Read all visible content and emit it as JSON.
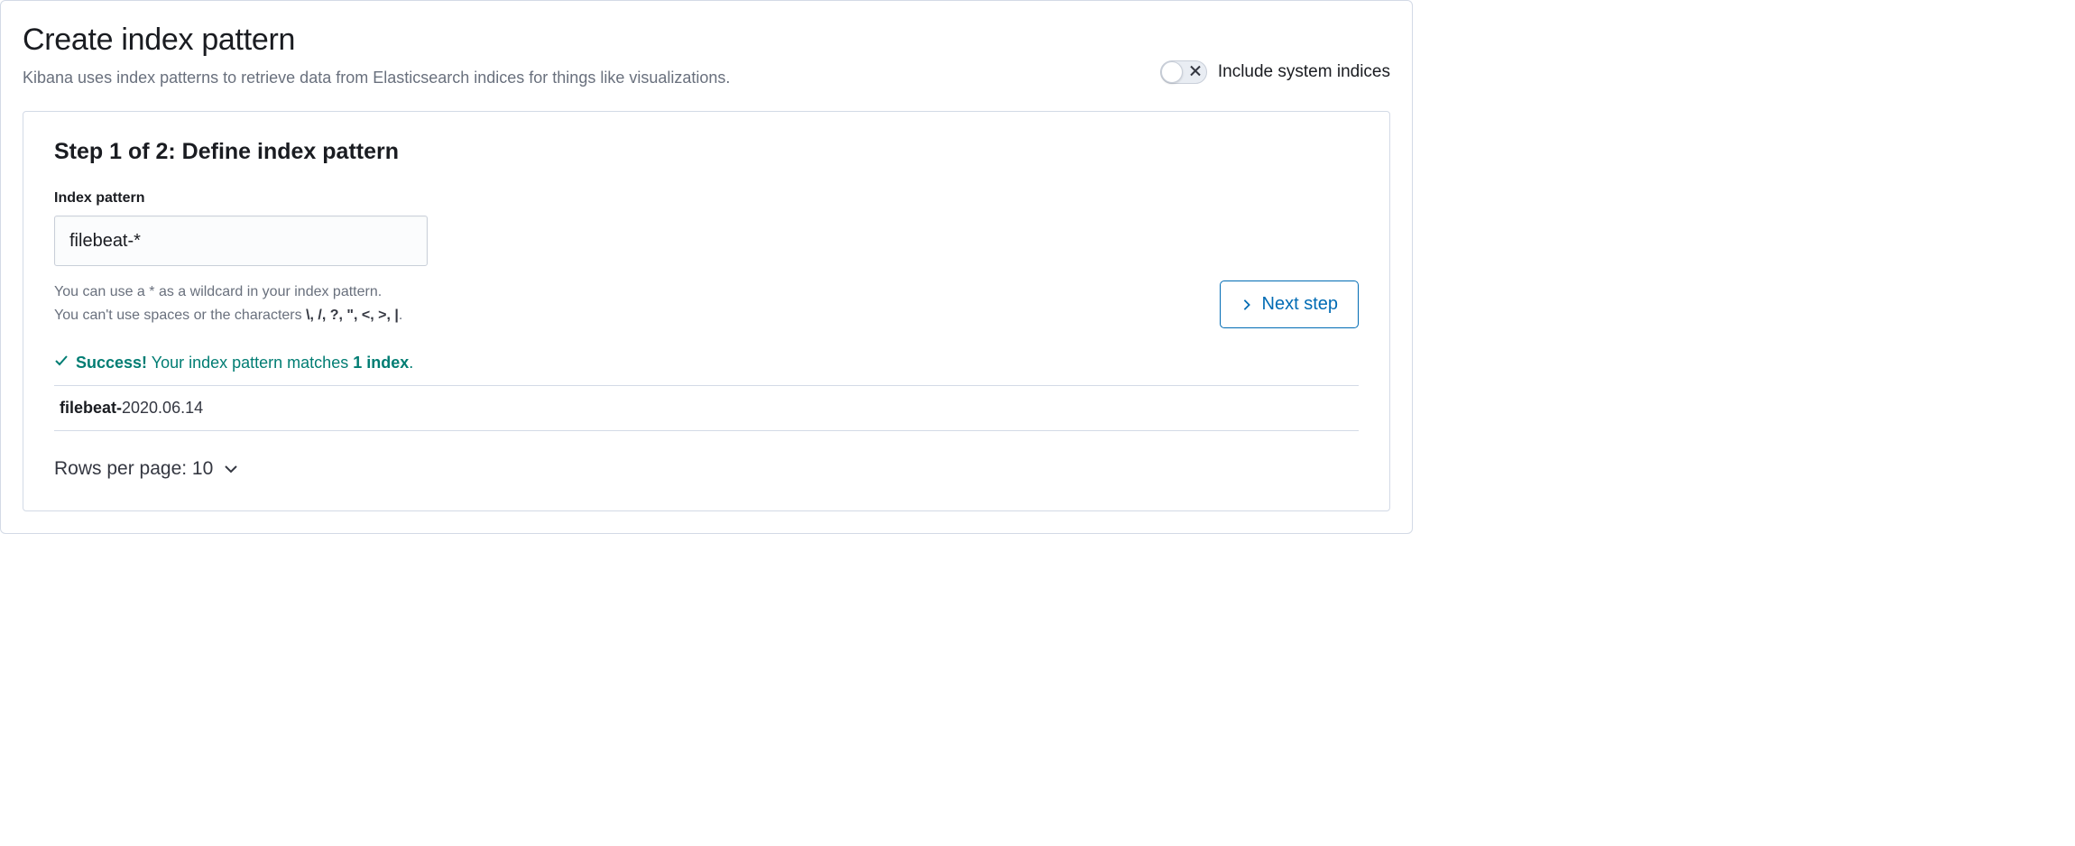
{
  "header": {
    "title": "Create index pattern",
    "subtitle": "Kibana uses index patterns to retrieve data from Elasticsearch indices for things like visualizations."
  },
  "toggle": {
    "label": "Include system indices",
    "on": false
  },
  "step": {
    "heading": "Step 1 of 2: Define index pattern",
    "field_label": "Index pattern",
    "input_value": "filebeat-*",
    "help_line_1": "You can use a * as a wildcard in your index pattern.",
    "help_line_2_prefix": "You can't use spaces or the characters ",
    "help_chars": "\\, /, ?, \", <, >, |",
    "help_line_2_suffix": ".",
    "next_button": "Next step"
  },
  "success": {
    "strong_prefix": "Success!",
    "mid_text": " Your index pattern matches ",
    "strong_count": "1 index",
    "suffix": "."
  },
  "matches": [
    {
      "prefix": "filebeat-",
      "suffix": "2020.06.14"
    }
  ],
  "pagination": {
    "rows_per_page_label": "Rows per page: ",
    "rows_per_page_value": "10"
  }
}
